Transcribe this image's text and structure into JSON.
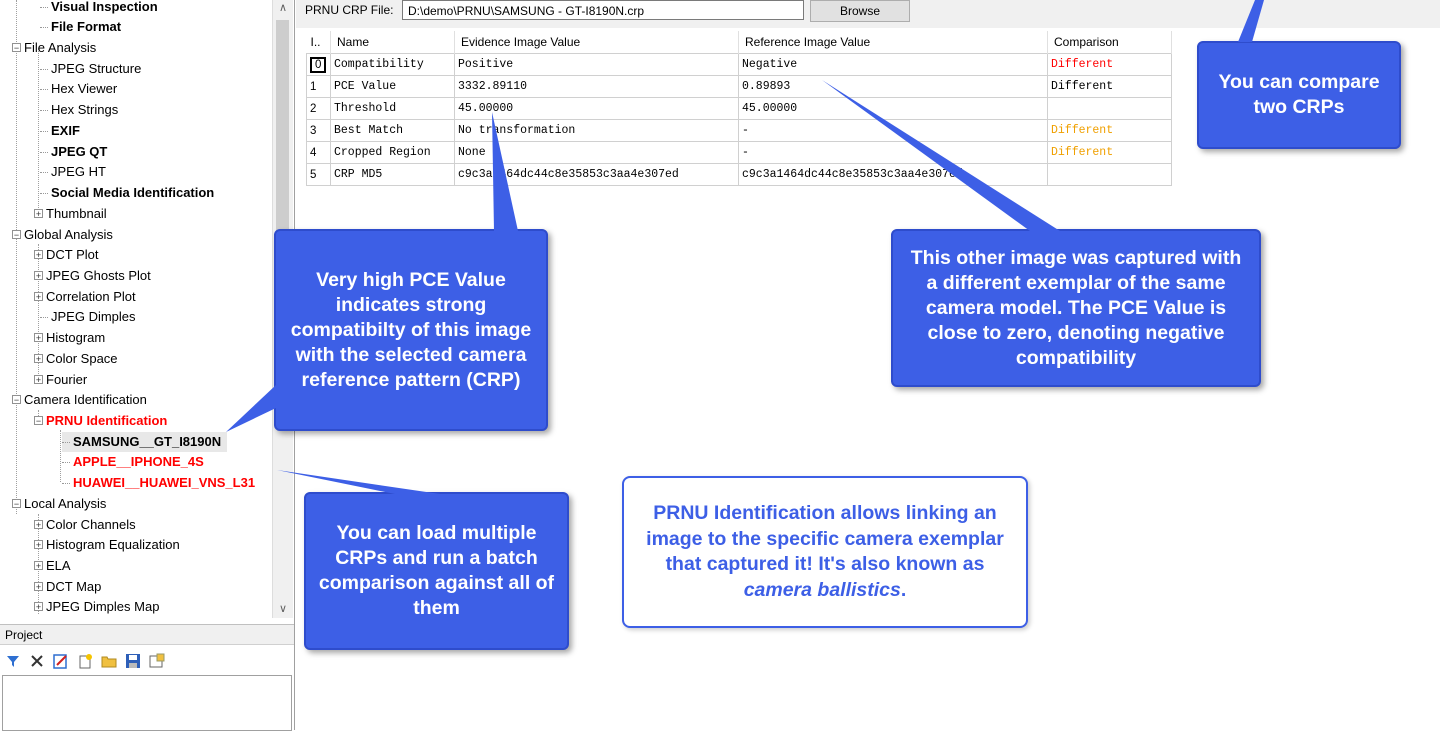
{
  "tree": {
    "items": [
      {
        "label": "Visual Inspection",
        "bold": true
      },
      {
        "label": "File Format",
        "bold": true
      },
      {
        "label": "File Analysis"
      },
      {
        "label": "JPEG Structure"
      },
      {
        "label": "Hex Viewer"
      },
      {
        "label": "Hex Strings"
      },
      {
        "label": "EXIF",
        "bold": true
      },
      {
        "label": "JPEG QT",
        "bold": true
      },
      {
        "label": "JPEG HT"
      },
      {
        "label": "Social Media Identification",
        "bold": true
      },
      {
        "label": "Thumbnail"
      },
      {
        "label": "Global Analysis"
      },
      {
        "label": "DCT Plot"
      },
      {
        "label": "JPEG Ghosts Plot"
      },
      {
        "label": "Correlation Plot"
      },
      {
        "label": "JPEG Dimples"
      },
      {
        "label": "Histogram"
      },
      {
        "label": "Color Space"
      },
      {
        "label": "Fourier"
      },
      {
        "label": "Camera Identification"
      },
      {
        "label": "PRNU Identification",
        "bold": true,
        "color": "#ff0000"
      },
      {
        "label": "SAMSUNG__GT_I8190N",
        "bold": true,
        "selected": true
      },
      {
        "label": "APPLE__IPHONE_4S",
        "bold": true,
        "color": "#ff0000"
      },
      {
        "label": "HUAWEI__HUAWEI_VNS_L31",
        "bold": true,
        "color": "#ff0000"
      },
      {
        "label": "Local Analysis"
      },
      {
        "label": "Color Channels"
      },
      {
        "label": "Histogram Equalization"
      },
      {
        "label": "ELA"
      },
      {
        "label": "DCT Map"
      },
      {
        "label": "JPEG Dimples Map"
      }
    ]
  },
  "project": {
    "title": "Project",
    "toolbar": [
      "filter-icon",
      "delete-icon",
      "edit-icon",
      "new-icon",
      "open-folder-icon",
      "save-icon",
      "properties-icon"
    ]
  },
  "crp": {
    "label": "PRNU CRP File:",
    "path": "D:\\demo\\PRNU\\SAMSUNG - GT-I8190N.crp",
    "browse": "Browse"
  },
  "grid": {
    "headers": [
      "I..",
      "Name",
      "Evidence Image Value",
      "Reference Image Value",
      "Comparison"
    ],
    "rows": [
      {
        "idx": "0",
        "name": "Compatibility",
        "evidence": "Positive",
        "reference": "Negative",
        "comparison": "Different",
        "cmp_color": "#ff0000"
      },
      {
        "idx": "1",
        "name": "PCE Value",
        "evidence": "3332.89110",
        "reference": "0.89893",
        "comparison": "Different",
        "cmp_color": "#000000"
      },
      {
        "idx": "2",
        "name": "Threshold",
        "evidence": "45.00000",
        "reference": "45.00000",
        "comparison": "",
        "cmp_color": "#000000"
      },
      {
        "idx": "3",
        "name": "Best Match",
        "evidence": "No transformation",
        "reference": " -",
        "comparison": "Different",
        "cmp_color": "#f0a000"
      },
      {
        "idx": "4",
        "name": "Cropped Region",
        "evidence": "None",
        "reference": " -",
        "comparison": "Different",
        "cmp_color": "#f0a000"
      },
      {
        "idx": "5",
        "name": "CRP MD5",
        "evidence": "c9c3a1464dc44c8e35853c3aa4e307ed",
        "reference": "c9c3a1464dc44c8e35853c3aa4e307ed",
        "comparison": "",
        "cmp_color": "#000000"
      }
    ]
  },
  "callouts": {
    "compare": "You can compare two CRPs",
    "pce": "Very high PCE Value indicates strong compatibilty of this image with the selected camera reference pattern (CRP)",
    "other": "This other image was captured with a different exemplar of the same camera model. The PCE Value is close to zero, denoting negative compatibility",
    "multiple": "You can load multiple CRPs and run a batch comparison against all of them"
  },
  "note": {
    "text": "PRNU Identification allows linking an image to the specific camera exemplar that captured it! It's also known as ",
    "emphasis": "camera ballistics",
    "end": "."
  },
  "colors": {
    "callout": "#3d5fe6",
    "different_red": "#ff0000",
    "different_orange": "#f0a000"
  }
}
